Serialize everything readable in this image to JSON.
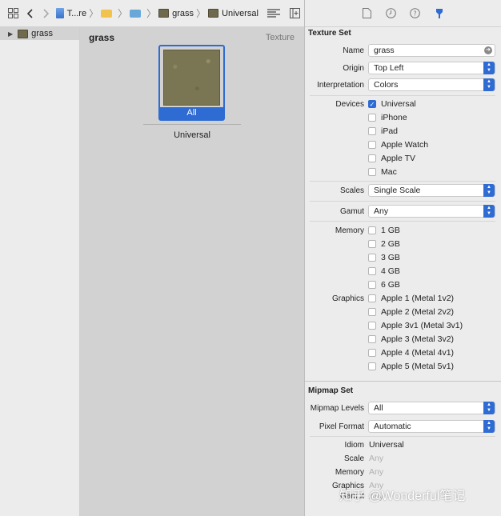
{
  "toolbar": {
    "crumbs": [
      "T...re",
      "",
      "",
      "grass",
      "Universal"
    ]
  },
  "outline": {
    "item": "grass"
  },
  "editor": {
    "title": "grass",
    "kind": "Texture",
    "slot_label": "All",
    "slot_caption": "Universal"
  },
  "inspector": {
    "texture_set": {
      "title": "Texture Set",
      "name_label": "Name",
      "name_value": "grass",
      "origin_label": "Origin",
      "origin_value": "Top Left",
      "interp_label": "Interpretation",
      "interp_value": "Colors",
      "devices_label": "Devices",
      "devices": [
        {
          "label": "Universal",
          "checked": true
        },
        {
          "label": "iPhone",
          "checked": false
        },
        {
          "label": "iPad",
          "checked": false
        },
        {
          "label": "Apple Watch",
          "checked": false
        },
        {
          "label": "Apple TV",
          "checked": false
        },
        {
          "label": "Mac",
          "checked": false
        }
      ],
      "scales_label": "Scales",
      "scales_value": "Single Scale",
      "gamut_label": "Gamut",
      "gamut_value": "Any",
      "memory_label": "Memory",
      "memory": [
        "1 GB",
        "2 GB",
        "3 GB",
        "4 GB",
        "6 GB"
      ],
      "graphics_label": "Graphics",
      "graphics": [
        "Apple 1 (Metal 1v2)",
        "Apple 2 (Metal 2v2)",
        "Apple 3v1 (Metal 3v1)",
        "Apple 3 (Metal 3v2)",
        "Apple 4 (Metal 4v1)",
        "Apple 5 (Metal 5v1)"
      ]
    },
    "mipmap_set": {
      "title": "Mipmap Set",
      "levels_label": "Mipmap Levels",
      "levels_value": "All",
      "pixel_label": "Pixel Format",
      "pixel_value": "Automatic",
      "idiom_label": "Idiom",
      "idiom_value": "Universal",
      "scale_label": "Scale",
      "scale_value": "Any",
      "memory_label": "Memory",
      "memory_value": "Any",
      "graphics_label": "Graphics",
      "graphics_value": "Any",
      "gamut_label": "Gamut",
      "gamut_value": "Any"
    }
  },
  "watermark": "知乎 @Wonderful笔记",
  "colors": {
    "accent": "#2e6bd3",
    "editor_bg": "#d2d2d2",
    "chrome_bg": "#ececec"
  }
}
